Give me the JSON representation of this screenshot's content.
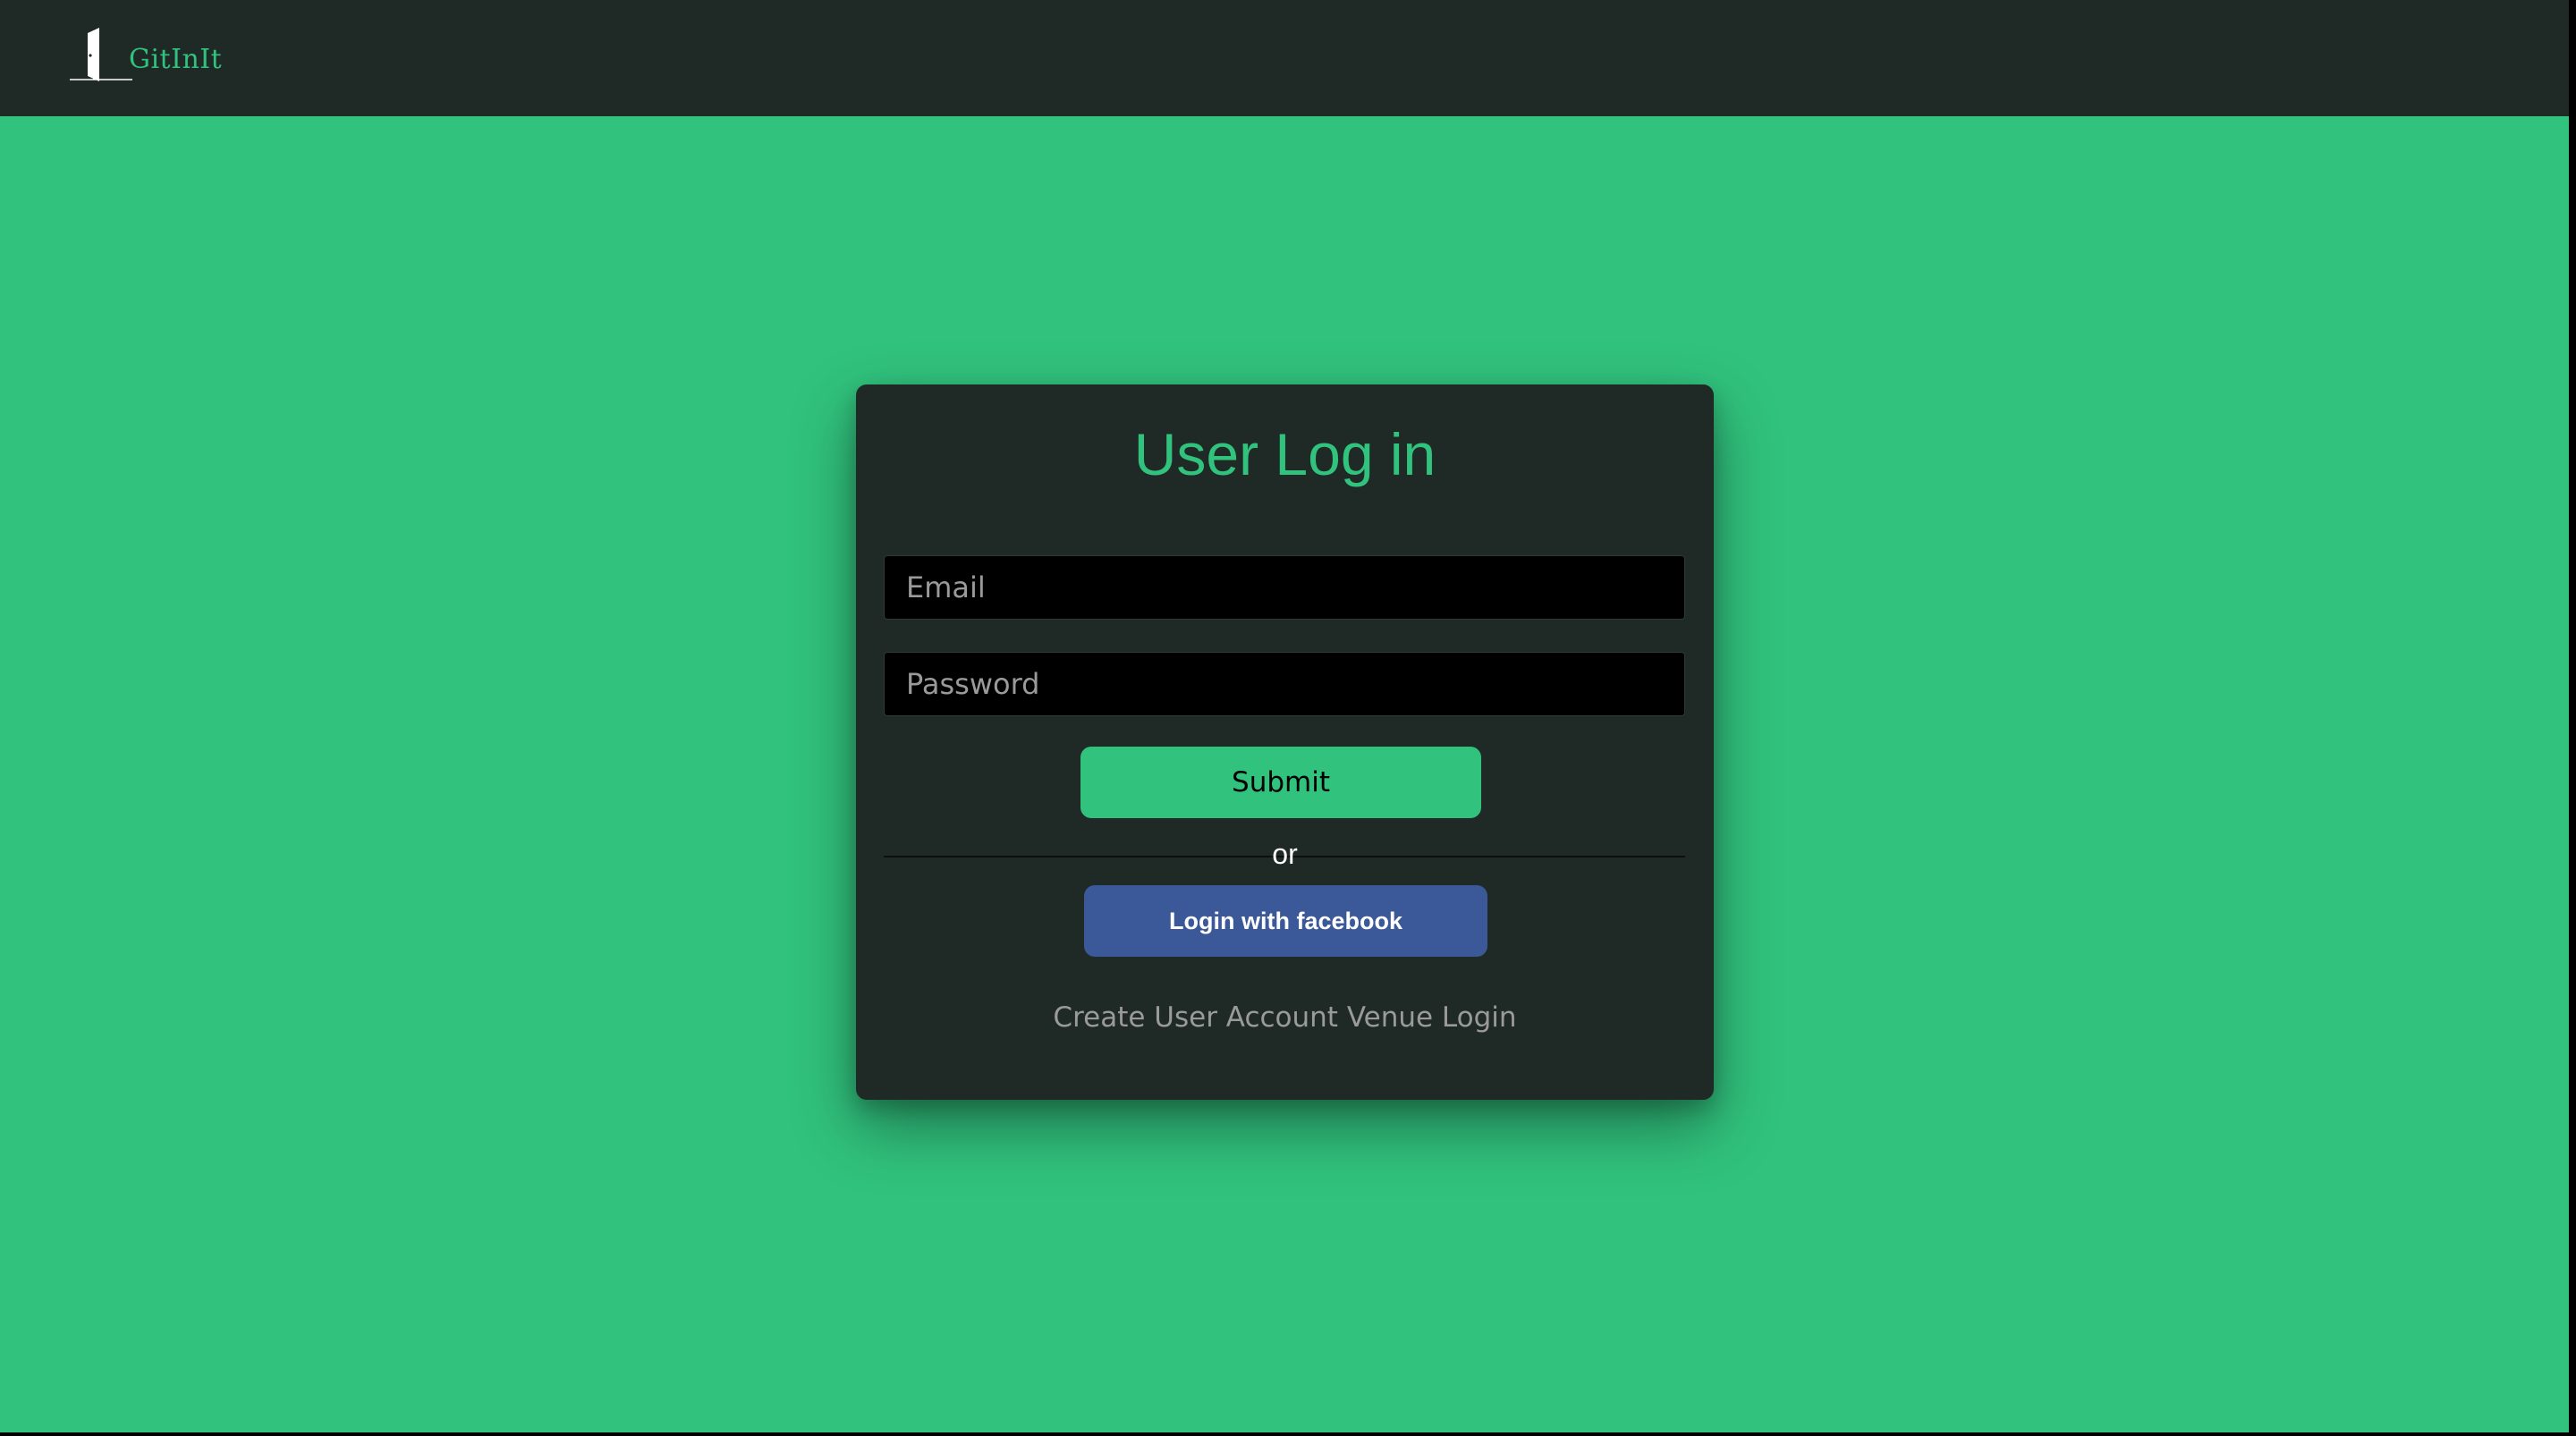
{
  "navbar": {
    "brand_name": "GitInIt",
    "logo_icon": "door-icon"
  },
  "login_card": {
    "title": "User Log in",
    "email_placeholder": "Email",
    "email_value": "",
    "password_placeholder": "Password",
    "password_value": "",
    "submit_label": "Submit",
    "divider_text": "or",
    "facebook_label": "Login with facebook",
    "create_account_link": "Create User Account",
    "venue_login_link": "Venue Login"
  },
  "colors": {
    "background": "#31c27d",
    "panel": "#1f2a27",
    "accent": "#31c27d",
    "facebook": "#3b5998",
    "input_background": "#000000",
    "link_text": "#9a9a9a"
  }
}
